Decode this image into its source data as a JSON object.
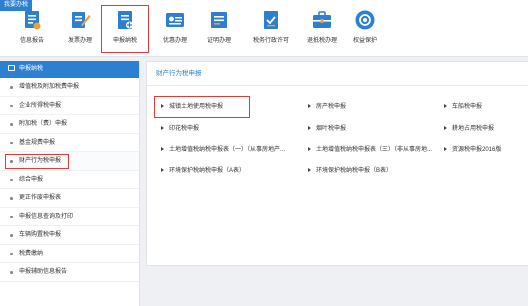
{
  "corner_tag": "我要办税",
  "toolbar": {
    "items": [
      {
        "label": "信息报告",
        "icon": "report-icon",
        "color": "#2d7fd0"
      },
      {
        "label": "发票办理",
        "icon": "invoice-icon",
        "color": "#2d7fd0"
      },
      {
        "label": "申报纳税",
        "icon": "declare-tax-icon",
        "color": "#2d7fd0"
      },
      {
        "label": "优惠办理",
        "icon": "discount-card-icon",
        "color": "#2d7fd0"
      },
      {
        "label": "证明办理",
        "icon": "certificate-icon",
        "color": "#2d7fd0"
      },
      {
        "label": "税务行政许可",
        "icon": "permit-icon",
        "color": "#2d7fd0"
      },
      {
        "label": "退抵税办理",
        "icon": "refund-briefcase-icon",
        "color": "#2d7fd0"
      },
      {
        "label": "权益保护",
        "icon": "rights-shield-icon",
        "color": "#2d7fd0"
      }
    ]
  },
  "sidebar": {
    "header": "申报纳税",
    "items": [
      {
        "label": "增值税及附加税费申报"
      },
      {
        "label": "企业所得税申报"
      },
      {
        "label": "附加税（费）申报"
      },
      {
        "label": "基金规费申报"
      },
      {
        "label": "财产行为税申报"
      },
      {
        "label": "综合申报"
      },
      {
        "label": "更正作废申报表"
      },
      {
        "label": "申报信息查询及打印"
      },
      {
        "label": "车辆购置税申报"
      },
      {
        "label": "税费缴纳"
      },
      {
        "label": "申报辅助信息报告"
      }
    ]
  },
  "main": {
    "title": "财产行为税申报",
    "links": [
      {
        "label": "城镇土地使用税申报"
      },
      {
        "label": "房产税申报"
      },
      {
        "label": "车船税申报"
      },
      {
        "label": "印花税申报"
      },
      {
        "label": "烟叶税申报"
      },
      {
        "label": "耕地占用税申报"
      },
      {
        "label": "土地增值税纳税申报表（一）（从事房地产..."
      },
      {
        "label": "土地增值税纳税申报表（三）（非从事房地..."
      },
      {
        "label": "资源税申报2016版"
      },
      {
        "label": "环境保护税纳税申报（A表）"
      },
      {
        "label": "环境保护税纳税申报（B表）"
      }
    ]
  },
  "colors": {
    "accent": "#2d7fd0",
    "highlight": "#e03b3b"
  }
}
